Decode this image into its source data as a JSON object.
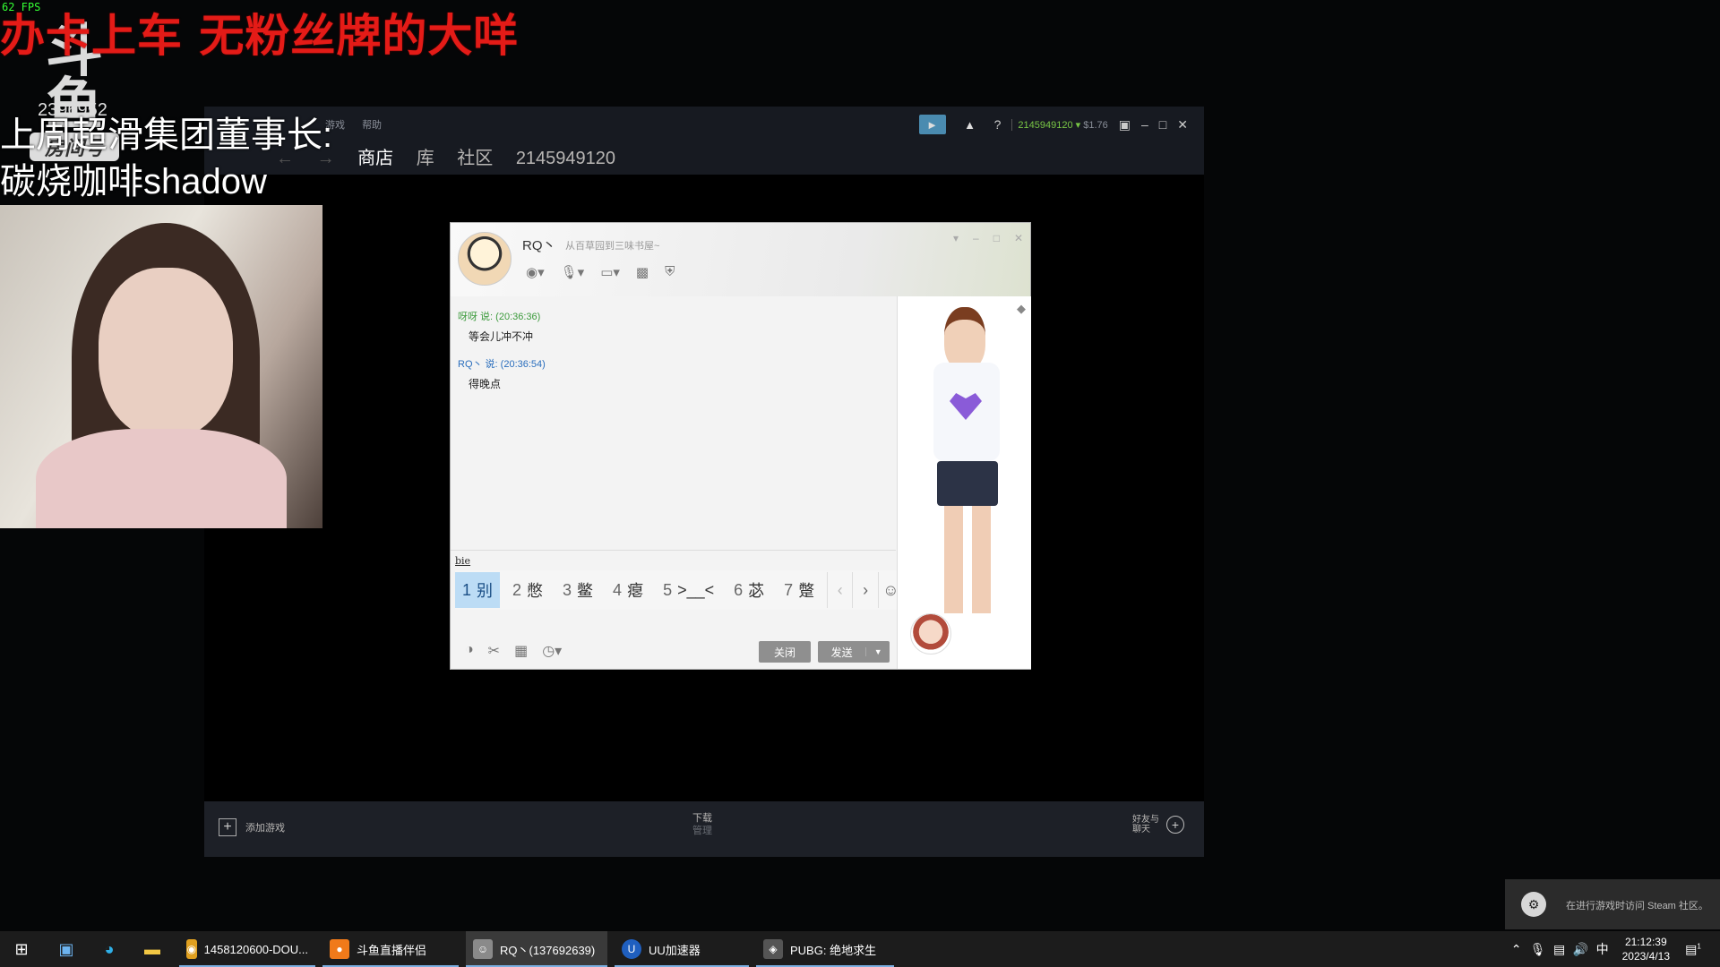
{
  "overlay": {
    "fps": "62 FPS",
    "banner": "办卡上车 无粉丝牌的大咩",
    "logo_mark": "斗鱼",
    "logo_room_label": "房间号",
    "room_number": "2396952",
    "line1": "上周超滑集团董事长:",
    "line2": "碳烧咖啡shadow"
  },
  "steam": {
    "menu": [
      "游戏",
      "帮助"
    ],
    "nav": [
      "商店",
      "库",
      "社区",
      "2145949120"
    ],
    "account": "2145949120",
    "balance": "$1.76",
    "help_label": "?",
    "add_game": "添加游戏",
    "downloads": "下载",
    "downloads_sub": "管理",
    "friends_line1": "好友与",
    "friends_line2": "聊天",
    "colors": {
      "accent": "#79c745",
      "titlebar": "#171a21",
      "bottombar": "#1d2027"
    }
  },
  "qq_chat": {
    "contact_name": "RQ丶",
    "signature": "从百草园到三味书屋~",
    "messages": [
      {
        "sender": "呀呀  说: (20:36:36)",
        "text": "等会儿冲不冲",
        "color": "green"
      },
      {
        "sender": "RQ丶  说: (20:36:54)",
        "text": "得晚点",
        "color": "blue"
      }
    ],
    "pinyin": "bie",
    "candidates": [
      {
        "num": "1",
        "text": "别"
      },
      {
        "num": "2",
        "text": "憋"
      },
      {
        "num": "3",
        "text": "鳖"
      },
      {
        "num": "4",
        "text": "瘪"
      },
      {
        "num": "5",
        "text": ">__<"
      },
      {
        "num": "6",
        "text": "苾"
      },
      {
        "num": "7",
        "text": "蹩"
      }
    ],
    "close_label": "关闭",
    "send_label": "发送"
  },
  "notification": {
    "text": "在进行游戏时访问 Steam 社区。"
  },
  "taskbar": {
    "apps": [
      {
        "label": "1458120600-DOU...",
        "icon": "owl-icon"
      },
      {
        "label": "斗鱼直播伴侣",
        "icon": "douyu-icon"
      },
      {
        "label": "RQ丶(137692639)",
        "icon": "qq-chat-icon"
      },
      {
        "label": "UU加速器",
        "icon": "uu-icon"
      },
      {
        "label": "PUBG: 绝地求生",
        "icon": "pubg-icon"
      }
    ],
    "ime_indicator": "中",
    "time": "21:12:39",
    "date": "2023/4/13",
    "notification_count": "1"
  }
}
